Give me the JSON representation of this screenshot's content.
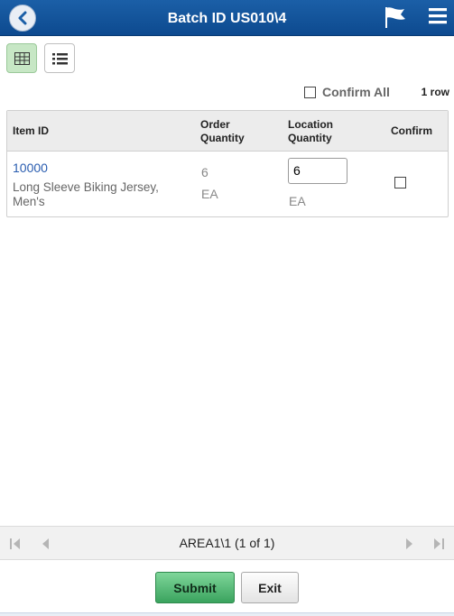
{
  "header": {
    "title": "Batch ID US010\\4",
    "back_icon": "chevron-left-icon",
    "flag_icon": "flag-icon",
    "menu_icon": "hamburger-menu-icon"
  },
  "toolbar": {
    "grid_view_icon": "grid-view-icon",
    "list_view_icon": "list-view-icon"
  },
  "confirm_all": {
    "label": "Confirm All",
    "checked": false
  },
  "row_count": "1 row",
  "table": {
    "columns": {
      "item_id": "Item ID",
      "order_qty_1": "Order",
      "order_qty_2": "Quantity",
      "loc_qty_1": "Location",
      "loc_qty_2": "Quantity",
      "confirm": "Confirm"
    },
    "rows": [
      {
        "item_id": "10000",
        "description": "Long Sleeve Biking Jersey, Men's",
        "order_quantity": "6",
        "order_uom": "EA",
        "location_quantity": "6",
        "location_uom": "EA",
        "confirmed": false
      }
    ]
  },
  "pager": {
    "label": "AREA1\\1 (1 of 1)"
  },
  "footer": {
    "submit_label": "Submit",
    "exit_label": "Exit"
  },
  "colors": {
    "header_bg": "#1b5fa7",
    "link": "#2a5db0",
    "submit_bg": "#3aa35e"
  }
}
